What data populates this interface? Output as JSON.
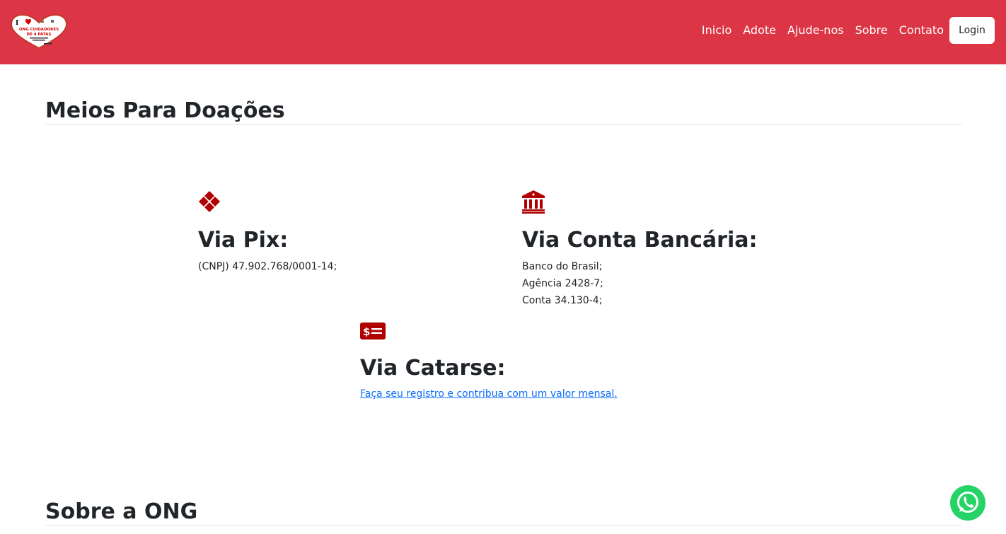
{
  "colors": {
    "brand": "#dc3545",
    "icon_red": "#b00000",
    "link": "#0d6efd",
    "whatsapp": "#25d366"
  },
  "nav": {
    "items": [
      "Inicio",
      "Adote",
      "Ajude-nos",
      "Sobre",
      "Contato"
    ],
    "login_label": "Login"
  },
  "logo": {
    "text": [
      "I",
      "ONG CUIDADORES",
      "DE 4 PATAS"
    ]
  },
  "donations": {
    "title": "Meios Para Doações",
    "pix": {
      "icon": "pix-icon",
      "title": "Via Pix:",
      "lines": [
        "(CNPJ) 47.902.768/0001-14;"
      ]
    },
    "bank": {
      "icon": "bank-icon",
      "title": "Via Conta Bancária:",
      "lines": [
        "Banco do Brasil;",
        "Agência 2428-7;",
        "Conta 34.130-4;"
      ]
    },
    "catarse": {
      "icon": "cash-icon",
      "title": "Via Catarse:",
      "link_text": "Faça seu registro e contribua com um valor mensal."
    }
  },
  "about": {
    "title": "Sobre a ONG"
  },
  "whatsapp": {
    "icon": "whatsapp-icon"
  }
}
